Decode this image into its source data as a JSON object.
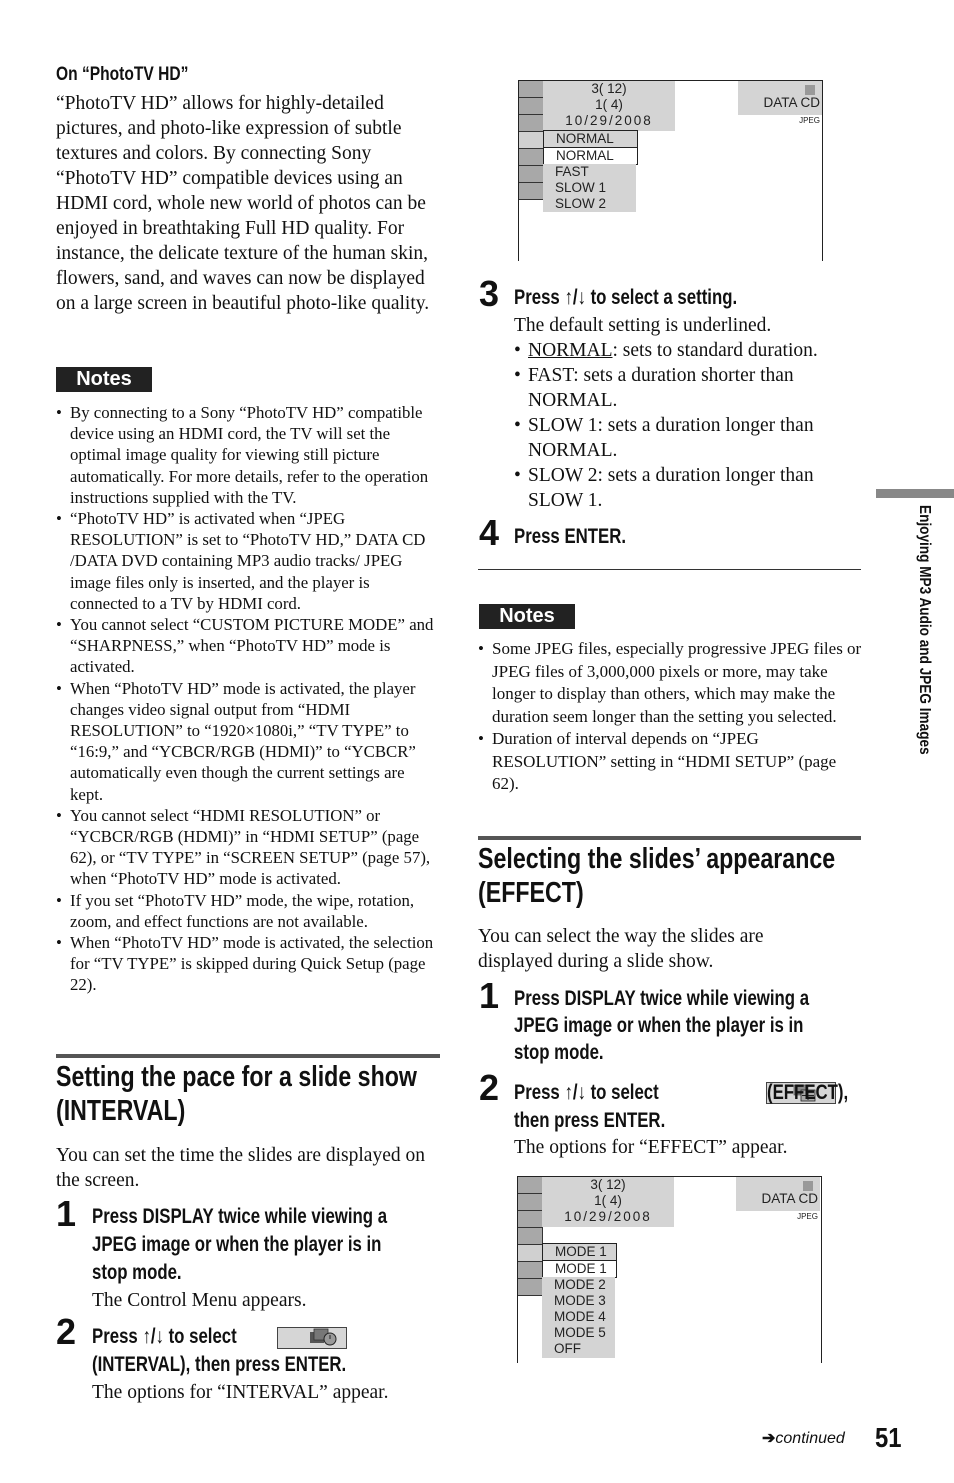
{
  "left": {
    "phototv": {
      "heading": "On “PhotoTV HD”",
      "paragraph": "“PhotoTV HD” allows for highly-detailed pictures, and photo-like expression of subtle textures and colors. By connecting Sony “PhotoTV HD” compatible devices using an HDMI cord, whole new world of photos can be enjoyed in breathtaking Full HD quality. For instance, the delicate texture of the human skin, flowers, sand, and waves can now be displayed on a large screen in beautiful photo-like quality."
    },
    "notes": {
      "label": "Notes",
      "items": [
        "By connecting to a Sony “PhotoTV HD” compatible device using an HDMI cord, the TV will set the optimal image quality for viewing still picture automatically. For more details, refer to the operation instructions supplied with the TV.",
        "“PhotoTV HD” is activated when “JPEG RESOLUTION” is set to “PhotoTV HD,” DATA CD /DATA DVD containing MP3 audio tracks/ JPEG image files only is inserted, and the player is connected to a TV by HDMI cord.",
        "You cannot select “CUSTOM PICTURE MODE” and “SHARPNESS,” when “PhotoTV HD” mode is activated.",
        "When “PhotoTV HD” mode is activated, the player changes video signal output from “HDMI RESOLUTION” to “1920×1080i,” “TV TYPE” to “16:9,” and “YCBCR/RGB (HDMI)” to “YCBCR” automatically even though the current settings are kept.",
        "You cannot select “HDMI RESOLUTION” or “YCBCR/RGB (HDMI)” in “HDMI SETUP” (page 62), or “TV TYPE” in “SCREEN SETUP” (page 57), when “PhotoTV HD” mode is activated.",
        "If you set “PhotoTV HD” mode, the wipe, rotation, zoom, and effect functions are not available.",
        "When “PhotoTV HD” mode is activated, the selection for “TV TYPE” is skipped during Quick Setup (page 22)."
      ]
    },
    "interval": {
      "title_line1": "Setting the pace for a slide show",
      "title_line2": "(INTERVAL)",
      "intro": "You can set the time the slides are displayed on the screen.",
      "step1_num": "1",
      "step1_line1": "Press DISPLAY twice while viewing a",
      "step1_line2": "JPEG image or when the player is in",
      "step1_line3": "stop mode.",
      "step1_result": "The Control Menu appears.",
      "step2_num": "2",
      "step2_line1_pre": "Press ↑/↓ to select",
      "step2_icon": "interval-icon",
      "step2_line2": "(INTERVAL), then press ENTER.",
      "step2_result": "The options for “INTERVAL” appear."
    }
  },
  "right": {
    "interval_osd": {
      "info_line1": "3(   12)",
      "info_line2": "1(      4)",
      "info_line3": "10/29/2008",
      "disc_label": "DATA CD",
      "disc_sub": "JPEG",
      "current": "NORMAL",
      "options": [
        "NORMAL",
        "FAST",
        "SLOW 1",
        "SLOW 2"
      ]
    },
    "step3": {
      "num": "3",
      "heading": "Press ↑/↓ to select a setting.",
      "intro": "The default setting is underlined.",
      "items": [
        {
          "term": "NORMAL",
          "desc": ": sets to standard duration."
        },
        {
          "term": "",
          "desc": "FAST: sets a duration shorter than NORMAL."
        },
        {
          "term": "",
          "desc": "SLOW 1: sets a duration longer than NORMAL."
        },
        {
          "term": "",
          "desc": "SLOW 2: sets a duration longer than SLOW 1."
        }
      ]
    },
    "step4": {
      "num": "4",
      "heading": "Press ENTER."
    },
    "notes": {
      "label": "Notes",
      "items": [
        "Some JPEG files, especially progressive JPEG files or JPEG files of 3,000,000 pixels or more, may take longer to display than others, which may make the duration seem longer than the setting you selected.",
        "Duration of interval depends on “JPEG RESOLUTION” setting in “HDMI SETUP” (page 62)."
      ]
    },
    "effect": {
      "title_line1": "Selecting the slides’ appearance",
      "title_line2": "(EFFECT)",
      "intro": "You can select the way the slides are displayed during a slide show.",
      "step1_num": "1",
      "step1_line1": "Press DISPLAY twice while viewing a",
      "step1_line2": "JPEG image or when the player is in",
      "step1_line3": "stop mode.",
      "step2_num": "2",
      "step2_pre": "Press ↑/↓ to select",
      "step2_icon": "effect-icon",
      "step2_post": "(EFFECT),",
      "step2_line2": "then press ENTER.",
      "step2_result": "The options for “EFFECT” appear."
    },
    "effect_osd": {
      "info_line1": "3(   12)",
      "info_line2": "1(      4)",
      "info_line3": "10/29/2008",
      "disc_label": "DATA CD",
      "disc_sub": "JPEG",
      "current": "MODE 1",
      "options": [
        "MODE 1",
        "MODE 2",
        "MODE 3",
        "MODE 4",
        "MODE 5",
        "OFF"
      ]
    }
  },
  "side_tab": {
    "label": "Enjoying MP3 Audio and JPEG Images"
  },
  "footer": {
    "continued": "continued",
    "page_number": "51"
  }
}
